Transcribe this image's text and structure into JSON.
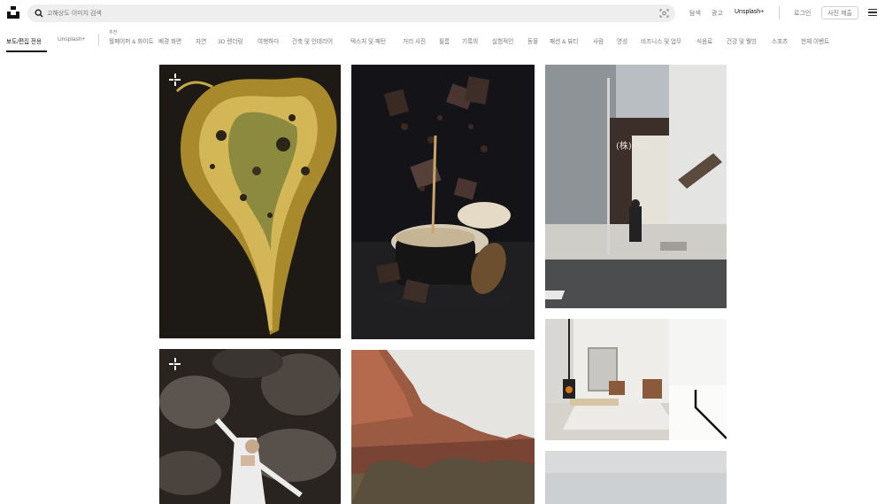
{
  "header": {
    "search_placeholder": "고해상도 이미지 검색",
    "links": {
      "explore": "탐색",
      "advertise": "광고",
      "unsplash_plus": "Unsplash+",
      "login": "로그인",
      "submit_photo": "사진 제출"
    }
  },
  "tabs": {
    "featured": "보도/편집 전용",
    "unsplash_plus": "Unsplash+",
    "recommended_label": "추천",
    "items": [
      "월페이퍼 & 화이트",
      "배경 화면",
      "자연",
      "3D 렌더링",
      "여행하다",
      "건축 및 인테리어",
      "텍스처 및 패턴",
      "거리 사진",
      "필름",
      "기록의",
      "실험적인",
      "동물",
      "패션 & 뷰티",
      "사람",
      "영성",
      "비즈니스 및 업무",
      "식음료",
      "건강 및 웰빙",
      "스포츠",
      "현재 이벤트"
    ]
  },
  "photos": [
    {
      "subject": "golden fluid art",
      "plus": true
    },
    {
      "subject": "chocolate coffee splash",
      "plus": false
    },
    {
      "subject": "street corner",
      "plus": false
    },
    {
      "subject": "minimal living room",
      "plus": false
    },
    {
      "subject": "person on rocks",
      "plus": true
    },
    {
      "subject": "red rock canyon",
      "plus": false
    },
    {
      "subject": "overcast sky",
      "plus": false
    }
  ],
  "colors": {
    "search_bg": "#eeeeee",
    "muted_text": "#767676",
    "active_text": "#111111",
    "border": "#d1d1d1"
  }
}
